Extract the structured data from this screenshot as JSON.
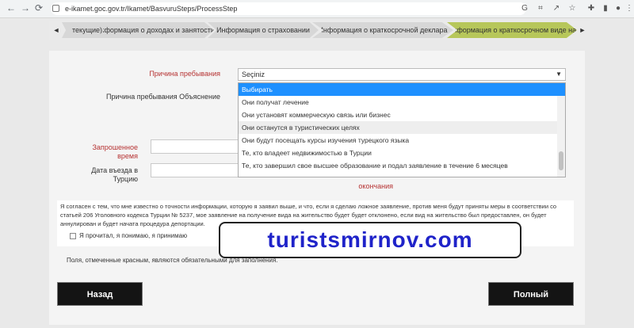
{
  "browser": {
    "back": "←",
    "forward": "→",
    "reload": "⟳",
    "url": "e-ikamet.goc.gov.tr/Ikamet/BasvuruSteps/ProcessStep",
    "icons": [
      "google-icon",
      "translate-icon",
      "share-icon",
      "bookmark-star-icon",
      "extensions-icon",
      "reading-list-icon",
      "profile-icon",
      "menu-dots-icon"
    ]
  },
  "steps": {
    "prev": "◄",
    "next": "►",
    "items": [
      {
        "label": "текущие)"
      },
      {
        "label": "Информация о доходах и занятости"
      },
      {
        "label": "Информация о страховании"
      },
      {
        "label": "Информация о краткосрочной деклара"
      },
      {
        "label": "Информация о краткосрочном виде на"
      }
    ]
  },
  "form": {
    "reason_label": "Причина пребывания",
    "reason_explain_label": "Причина пребывания Объяснение",
    "requested_time_label": "Запрошенное время",
    "entry_date_label": "Дата въезда в Турцию",
    "end_label": "окончания",
    "select_value": "Seçiniz",
    "options": [
      {
        "text": "Выбирать"
      },
      {
        "text": "Они получат лечение"
      },
      {
        "text": "Они установят коммерческую связь или бизнес"
      },
      {
        "text": "Они останутся в туристических целях"
      },
      {
        "text": "Они будут посещать курсы изучения турецкого языка"
      },
      {
        "text": "Те, кто владеет недвижимостью в Турции"
      },
      {
        "text": "Те, кто завершил свое высшее образование и подал заявление в течение 6 месяцев"
      }
    ]
  },
  "agreement": {
    "text": "Я согласен с тем, что мне известно о точности информации, которую я заявил выше, и что, если я сделаю ложное заявление, против меня будут приняты меры в соответствии со статьей 206 Уголовного кодекса Турции № 5237, мое заявление на получение вида на жительство будет будет отклонено, если вид на жительство был предоставлен, он будет аннулирован и будет начата процедура депортации.",
    "checkbox_label": "Я прочитал, я понимаю, я принимаю"
  },
  "note": "Поля, отмеченные красным, являются обязательными для заполнения.",
  "buttons": {
    "back": "Назад",
    "finish": "Полный"
  },
  "watermark": "turistsmirnov.com",
  "colors": {
    "required": "#b63333",
    "active_step": "#b7c75a",
    "highlight": "#1e90ff",
    "watermark": "#1f23c9"
  }
}
